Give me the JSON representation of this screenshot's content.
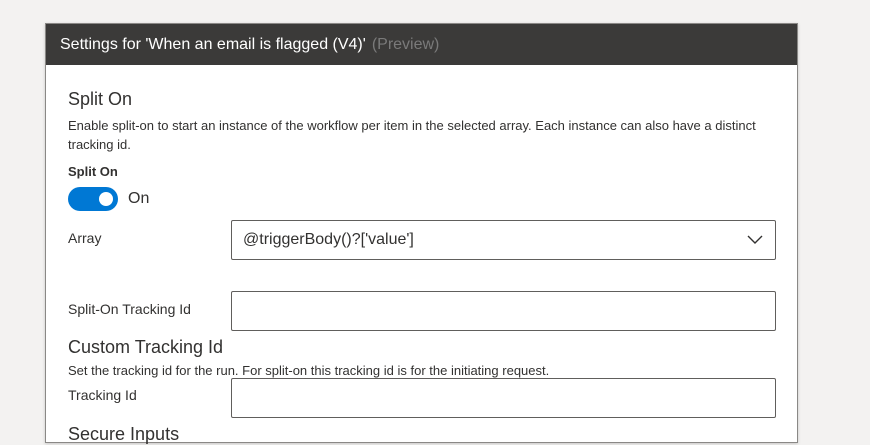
{
  "dialog": {
    "title": "Settings for 'When an email is flagged (V4)'",
    "preview_label": "(Preview)"
  },
  "split_on": {
    "section_title": "Split On",
    "description": "Enable split-on to start an instance of the workflow per item in the selected array. Each instance can also have a distinct tracking id.",
    "toggle_label": "Split On",
    "toggle_state_text": "On",
    "toggle_on": true,
    "array_label": "Array",
    "array_value": "@triggerBody()?['value']",
    "tracking_id_label": "Split-On Tracking Id",
    "tracking_id_value": ""
  },
  "custom_tracking": {
    "section_title": "Custom Tracking Id",
    "description": "Set the tracking id for the run. For split-on this tracking id is for the initiating request.",
    "tracking_id_label": "Tracking Id",
    "tracking_id_value": ""
  },
  "secure_inputs": {
    "section_title": "Secure Inputs"
  },
  "colors": {
    "header_bg": "#3b3a39",
    "toggle_on": "#0078d4",
    "input_border": "#605e5c"
  },
  "icons": {
    "array_dropdown": "chevron-down-icon"
  }
}
